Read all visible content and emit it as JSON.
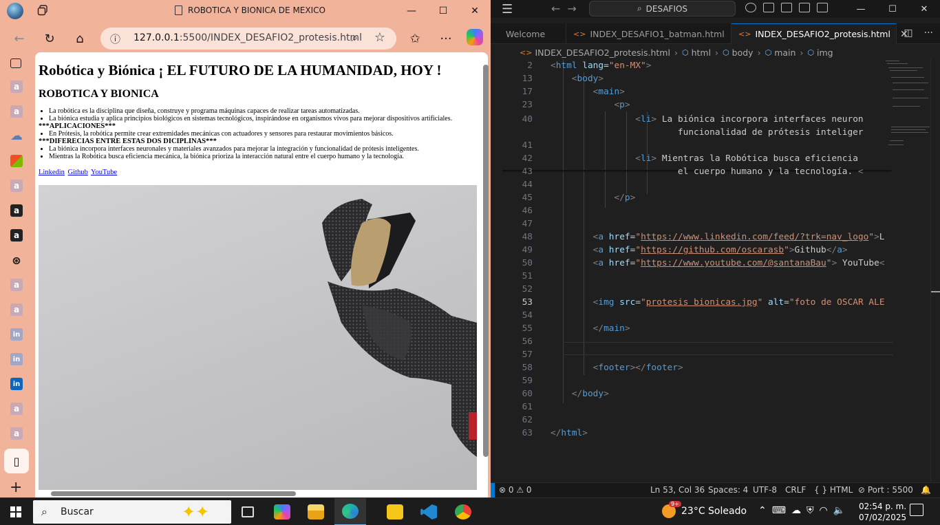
{
  "edge": {
    "window_title": "ROBOTICA Y BIONICA DE MEXICO",
    "address": {
      "host": "127.0.0.1",
      "path": ":5500/INDEX_DESAFIO2_protesis.html"
    },
    "controls": {
      "minimize": "—",
      "maximize": "☐",
      "close": "✕"
    },
    "sidebar_icons": [
      "workspaces-icon",
      "amazon-icon",
      "amazon-icon",
      "amazon-icon",
      "onedrive-icon",
      "office-icon",
      "amazon-icon",
      "amazon-icon",
      "amazon-icon",
      "chatgpt-icon",
      "amazon-icon",
      "amazon-icon",
      "linkedin-icon",
      "linkedin-icon",
      "linkedin-icon",
      "amazon-icon",
      "amazon-icon",
      "page-icon"
    ]
  },
  "page": {
    "h1": "Robótica y Biónica ¡ EL FUTURO DE LA HUMANIDAD, HOY !",
    "h2": "ROBOTICA Y BIONICA",
    "bullets_1": [
      "La robótica es la disciplina que diseña, construye y programa máquinas capaces de realizar tareas automatizadas.",
      "La biónica estudia y aplica principios biológicos en sistemas tecnológicos, inspirándose en organismos vivos para mejorar dispositivos artificiales."
    ],
    "section_1": "***APLICACIONES***",
    "bullets_2": [
      "En Prótesis, la robótica permite crear extremidades mecánicas con actuadores y sensores para restaurar movimientos básicos."
    ],
    "section_2": "***DIFERECIAS ENTRE ESTAS DOS DICIPLINAS***",
    "bullets_3": [
      "La biónica incorpora interfaces neuronales y materiales avanzados para mejorar la integración y funcionalidad de prótesis inteligentes.",
      "Mientras la Robótica busca eficiencia mecánica, la biónica prioriza la interacción natural entre el cuerpo humano y la tecnología."
    ],
    "links": [
      "Linkedin",
      "Github",
      "YouTube"
    ]
  },
  "vscode": {
    "search_label": "DESAFIOS",
    "tabs": [
      {
        "label": "Welcome"
      },
      {
        "label": "INDEX_DESAFIO1_batman.html"
      },
      {
        "label": "INDEX_DESAFIO2_protesis.html",
        "active": true
      }
    ],
    "breadcrumb": [
      "INDEX_DESAFIO2_protesis.html",
      "html",
      "body",
      "main",
      "img"
    ],
    "status": {
      "problems": "⊗ 0 ⚠ 0",
      "position": "Ln 53, Col 36",
      "spaces": "Spaces: 4",
      "encoding": "UTF-8",
      "eol": "CRLF",
      "language": "{ }  HTML",
      "port": "⊘ Port : 5500",
      "bell": "🔔"
    },
    "line_numbers": [
      "2",
      "13",
      "17",
      "23",
      "40",
      "",
      "41",
      "42",
      "43",
      "44",
      "45",
      "46",
      "47",
      "48",
      "49",
      "50",
      "51",
      "52",
      "53",
      "54",
      "55",
      "56",
      "57",
      "58",
      "59",
      "60",
      "61",
      "62",
      "63"
    ]
  },
  "taskbar": {
    "search_placeholder": "Buscar",
    "weather": "23°C  Soleado",
    "weather_badge": "9+",
    "time": "02:54 p. m.",
    "date": "07/02/2025"
  }
}
